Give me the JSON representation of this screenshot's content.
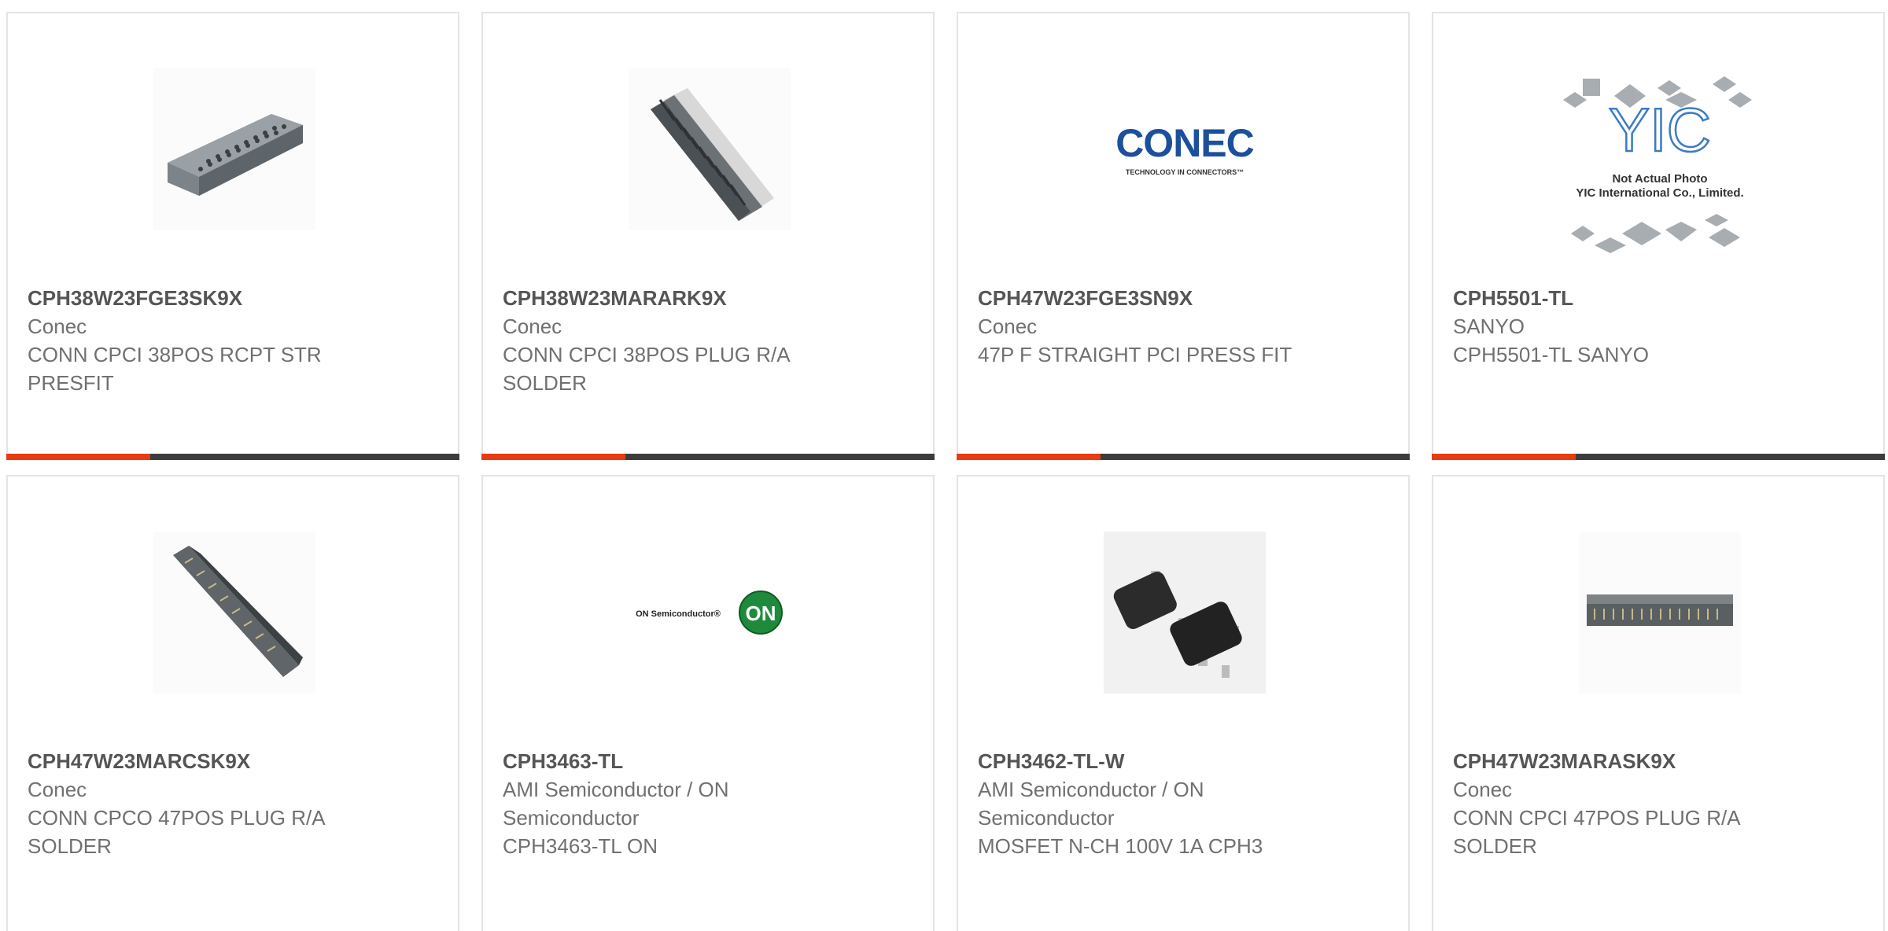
{
  "products": [
    {
      "part": "CPH38W23FGE3SK9X",
      "manufacturer": "Conec",
      "description": "CONN CPCI 38POS RCPT STR PRESFIT"
    },
    {
      "part": "CPH38W23MARARK9X",
      "manufacturer": "Conec",
      "description": "CONN CPCI 38POS PLUG R/A SOLDER"
    },
    {
      "part": "CPH47W23FGE3SN9X",
      "manufacturer": "Conec",
      "description": "47P F STRAIGHT PCI PRESS FIT",
      "logo": {
        "name": "CONEC",
        "tagline": "TECHNOLOGY IN CONNECTORS™"
      }
    },
    {
      "part": "CPH5501-TL",
      "manufacturer": "SANYO",
      "description": "CPH5501-TL SANYO",
      "placeholder": {
        "mark": "YIC",
        "line1": "Not Actual Photo",
        "line2": "YIC International Co., Limited."
      }
    },
    {
      "part": "CPH47W23MARCSK9X",
      "manufacturer": "Conec",
      "description": "CONN CPCO 47POS PLUG R/A SOLDER"
    },
    {
      "part": "CPH3463-TL",
      "manufacturer": "AMI Semiconductor / ON Semiconductor",
      "description": "CPH3463-TL ON",
      "logo": {
        "name": "ON Semiconductor®",
        "badge": "ON"
      }
    },
    {
      "part": "CPH3462-TL-W",
      "manufacturer": "AMI Semiconductor / ON Semiconductor",
      "description": "MOSFET N-CH 100V 1A CPH3"
    },
    {
      "part": "CPH47W23MARASK9X",
      "manufacturer": "Conec",
      "description": "CONN CPCI 47POS PLUG R/A SOLDER"
    }
  ],
  "icons": [
    "connector-rcpt-photo",
    "connector-plug-photo",
    "conec-logo",
    "not-actual-photo-placeholder",
    "connector-angled-photo",
    "on-semiconductor-logo",
    "sot23-package-photo",
    "connector-ra-photo"
  ],
  "colors": {
    "accent_highlight": "#e63c12",
    "accent_bar": "#3d3d3d",
    "card_border": "#e4e4e4",
    "part_text": "#555555",
    "body_text": "#707070",
    "conec_blue": "#1c4f9c",
    "on_green": "#1f8a3c"
  }
}
